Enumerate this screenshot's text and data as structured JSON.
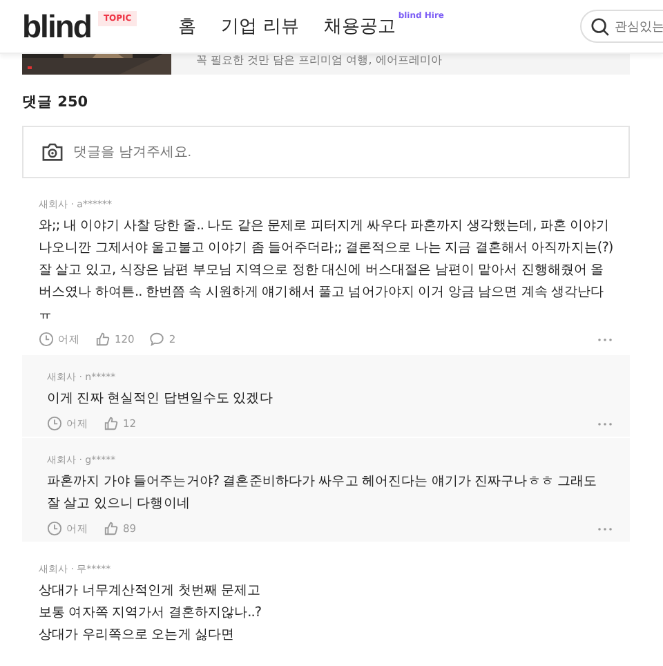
{
  "header": {
    "logo": "blind",
    "badge": "TOPIC",
    "nav": [
      {
        "label": "홈"
      },
      {
        "label": "기업 리뷰"
      },
      {
        "label": "채용공고",
        "tag": "blind Hire"
      }
    ],
    "search": {
      "placeholder": "관심있는"
    }
  },
  "ad": {
    "kind": "picture",
    "text": "꼭 필요한 것만 담은 프리미엄 여행, 에어프레미아"
  },
  "comments_heading": "댓글 250",
  "comment_input": {
    "placeholder": "댓글을 남겨주세요."
  },
  "comments": [
    {
      "author": "새회사 · a******",
      "text": "와;; 내 이야기 사찰 당한 줄.. 나도 같은 문제로 피터지게 싸우다 파혼까지 생각했는데, 파혼 이야기나오니깐 그제서야 울고불고 이야기 좀 들어주더라;; 결론적으로 나는 지금 결혼해서 아직까지는(?) 잘 살고 있고, 식장은 남편 부모님 지역으로 정한 대신에 버스대절은 남편이 맡아서 진행해줬어 올버스였나 하여튼.. 한번쯤 속 시원하게 얘기해서 풀고 넘어가야지 이거 앙금 남으면 계속 생각난다ㅠ",
      "time": "어제",
      "likes": "120",
      "replies_count": "2",
      "replies": [
        {
          "author": "새회사 · n*****",
          "text": "이게 진짜 현실적인 답변일수도 있겠다",
          "time": "어제",
          "likes": "12"
        },
        {
          "author": "새회사 · g*****",
          "text": "파혼까지 가야 들어주는거야? 결혼준비하다가 싸우고 헤어진다는 얘기가 진짜구나ㅎㅎ 그래도 잘 살고 있으니 다행이네",
          "time": "어제",
          "likes": "89"
        }
      ]
    },
    {
      "author": "새회사 · 무*****",
      "lines": [
        "상대가 너무계산적인게 첫번째 문제고",
        "보통 여자쪽 지역가서 결혼하지않나..?",
        "상대가 우리쪽으로 오는게 싫다면"
      ]
    }
  ]
}
